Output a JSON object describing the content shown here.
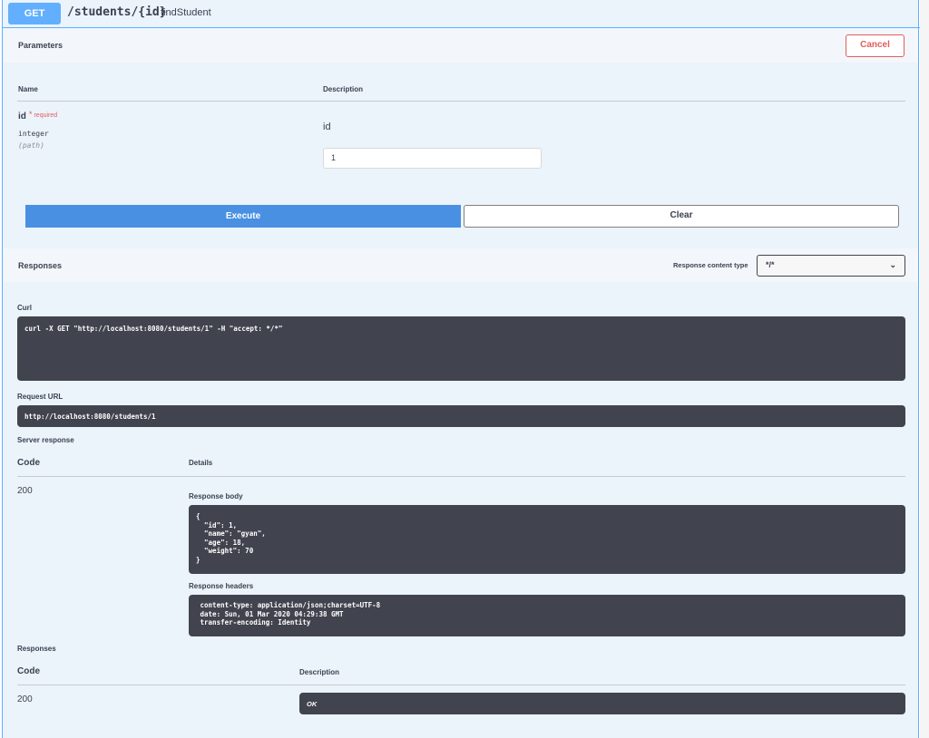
{
  "operation": {
    "method": "GET",
    "path": "/students/{id}",
    "summary": "findStudent"
  },
  "parameters": {
    "title": "Parameters",
    "cancel_label": "Cancel",
    "col_name": "Name",
    "col_description": "Description",
    "items": [
      {
        "name": "id",
        "required_label": "required",
        "type": "integer",
        "in": "(path)",
        "description": "id",
        "value": "1"
      }
    ]
  },
  "actions": {
    "execute_label": "Execute",
    "clear_label": "Clear"
  },
  "responses_section": {
    "title": "Responses",
    "content_type_label": "Response content type",
    "content_type_value": "*/*"
  },
  "curl": {
    "label": "Curl",
    "command": "curl -X GET \"http://localhost:8080/students/1\" -H \"accept: */*\""
  },
  "request_url": {
    "label": "Request URL",
    "value": "http://localhost:8080/students/1"
  },
  "server_response": {
    "label": "Server response",
    "col_code": "Code",
    "col_details": "Details",
    "code": "200",
    "body_label": "Response body",
    "body": "{\n  \"id\": 1,\n  \"name\": \"gyan\",\n  \"age\": 18,\n  \"weight\": 70\n}",
    "headers_label": "Response headers",
    "headers": " content-type: application/json;charset=UTF-8\n date: Sun, 01 Mar 2020 04:29:38 GMT\n transfer-encoding: Identity"
  },
  "documented_responses": {
    "label": "Responses",
    "col_code": "Code",
    "col_description": "Description",
    "code": "200",
    "description": "OK"
  },
  "colors": {
    "get_blue": "#61affe",
    "execute_blue": "#4990e2",
    "cancel_red": "#e35c5c",
    "code_bg": "#41444e"
  }
}
